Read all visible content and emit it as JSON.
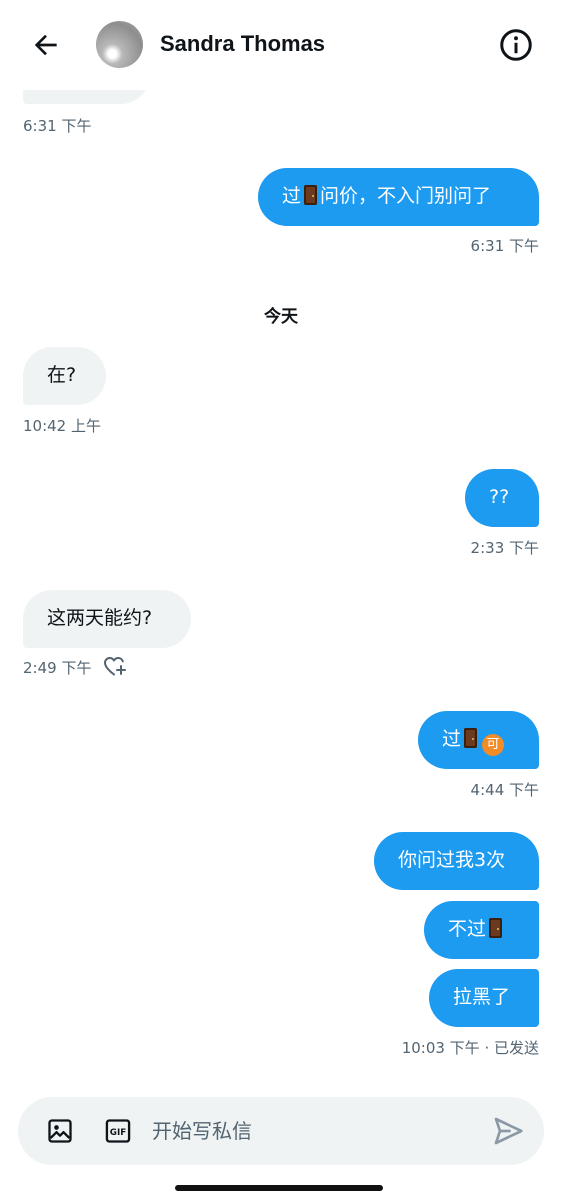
{
  "header": {
    "contact_name": "Sandra Thomas"
  },
  "conversation": {
    "partial_timestamp": "6:31 下午",
    "messages": [
      {
        "id": "m1",
        "direction": "out",
        "text_before": "过",
        "emoji": "door",
        "text_after": "问价，不入门别问了",
        "time": "6:31 下午"
      },
      {
        "id": "m2",
        "direction": "in",
        "text": "在?",
        "time": "10:42 上午"
      },
      {
        "id": "m3",
        "direction": "out",
        "text": "??",
        "time": "2:33 下午"
      },
      {
        "id": "m4",
        "direction": "in",
        "text": "这两天能约?",
        "time": "2:49 下午"
      },
      {
        "id": "m5",
        "direction": "out",
        "text_before": "过",
        "emoji": "door",
        "badge": "可",
        "time": "4:44 下午"
      },
      {
        "id": "m6",
        "direction": "out",
        "text": "你问过我3次"
      },
      {
        "id": "m7",
        "direction": "out",
        "text_before": "不过",
        "emoji": "door"
      },
      {
        "id": "m8",
        "direction": "out",
        "text": "拉黑了",
        "time": "10:03 下午 · 已发送"
      }
    ],
    "date_separator": "今天"
  },
  "composer": {
    "placeholder": "开始写私信"
  },
  "icons": {
    "back": "arrow-left-icon",
    "info": "info-icon",
    "image": "image-icon",
    "gif": "gif-icon",
    "send": "send-icon",
    "react": "heart-plus-icon"
  },
  "colors": {
    "outgoing_bubble": "#1d9bf0",
    "incoming_bubble": "#eff3f4",
    "timestamp": "#536471"
  }
}
